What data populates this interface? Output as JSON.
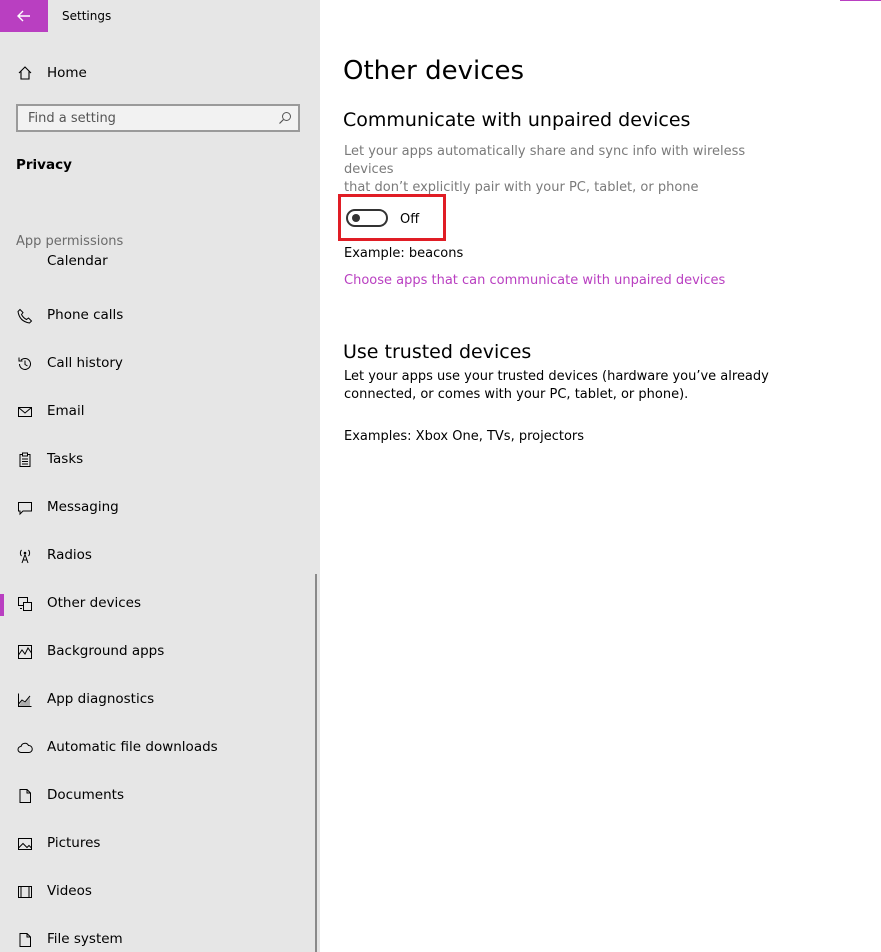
{
  "colors": {
    "accent": "#b93fc1",
    "sidebar_bg": "#e6e6e6",
    "highlight": "#e01d25"
  },
  "titlebar": {
    "title": "Settings",
    "back_icon": "arrow-left-icon"
  },
  "sidebar": {
    "home_label": "Home",
    "search_placeholder": "Find a setting",
    "section_title": "Privacy",
    "permissions_header": "App permissions",
    "partial_item": "Calendar",
    "items": [
      {
        "label": "Phone calls",
        "icon": "phone-icon"
      },
      {
        "label": "Call history",
        "icon": "history-icon"
      },
      {
        "label": "Email",
        "icon": "email-icon"
      },
      {
        "label": "Tasks",
        "icon": "tasks-icon"
      },
      {
        "label": "Messaging",
        "icon": "messaging-icon"
      },
      {
        "label": "Radios",
        "icon": "radio-antenna-icon"
      },
      {
        "label": "Other devices",
        "icon": "devices-icon",
        "selected": true
      },
      {
        "label": "Background apps",
        "icon": "background-apps-icon"
      },
      {
        "label": "App diagnostics",
        "icon": "diagnostics-icon"
      },
      {
        "label": "Automatic file downloads",
        "icon": "cloud-icon"
      },
      {
        "label": "Documents",
        "icon": "document-icon"
      },
      {
        "label": "Pictures",
        "icon": "pictures-icon"
      },
      {
        "label": "Videos",
        "icon": "video-icon"
      },
      {
        "label": "File system",
        "icon": "file-icon"
      }
    ]
  },
  "main": {
    "title": "Other devices",
    "unpaired": {
      "heading": "Communicate with unpaired devices",
      "description_line1": "Let your apps automatically share and sync info with wireless devices",
      "description_line2": "that don’t explicitly pair with your PC, tablet, or phone",
      "toggle_state": "Off",
      "example": "Example: beacons",
      "link": "Choose apps that can communicate with unpaired devices"
    },
    "trusted": {
      "heading": "Use trusted devices",
      "description_line1": "Let your apps use your trusted devices (hardware you’ve already",
      "description_line2": "connected, or comes with your PC, tablet, or phone).",
      "examples": "Examples: Xbox One, TVs, projectors"
    }
  }
}
